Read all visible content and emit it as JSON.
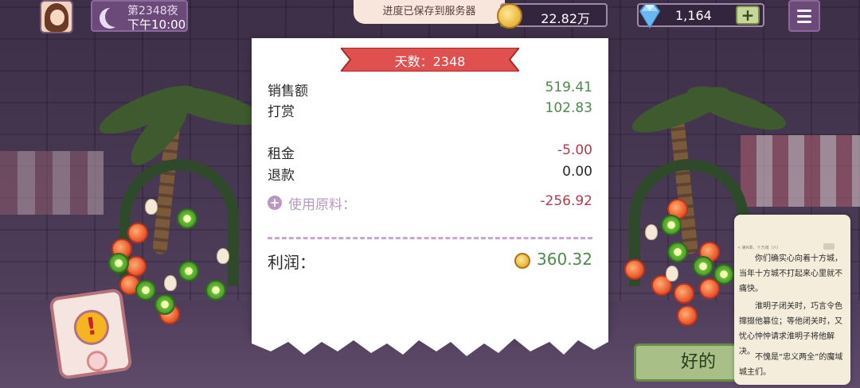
{
  "hud": {
    "day_label": "第2348夜",
    "time_label": "下午10:00",
    "save_toast": "进度已保存到服务器",
    "coins": "22.82万",
    "gems": "1,164",
    "add_gems_symbol": "+"
  },
  "receipt": {
    "ribbon_title": "天数：2348",
    "rows": [
      {
        "label": "销售额",
        "value": "519.41"
      },
      {
        "label": "打赏",
        "value": "102.83"
      },
      {
        "label": "租金",
        "value": "-5.00"
      },
      {
        "label": "退款",
        "value": "0.00"
      }
    ],
    "materials_label": "使用原料：",
    "materials_value": "-256.92",
    "profit_label": "利润：",
    "profit_value": "360.32"
  },
  "alert_symbol": "!",
  "ok_button_label": "好的",
  "book_panel": {
    "header": "< 第N章，十方城（六）",
    "paragraphs": [
      "你们确实心向着十方城，当年十方城不打起来心里就不痛快。",
      "淮明子闭关时，巧言令色撺掇他篡位；等他闭关时，又忧心忡忡请求淮明子将他解决。",
      "不愧是“忠义两全”的魔域城主们。"
    ]
  },
  "colors": {
    "profit_green": "#4c8a4a",
    "expense_red": "#b33a4e",
    "ribbon_red": "#e0504f",
    "ok_button_green": "#a8c088"
  },
  "icons": [
    "moon-icon",
    "coin-icon",
    "diamond-icon",
    "menu-icon",
    "plus-icon",
    "alert-icon"
  ]
}
